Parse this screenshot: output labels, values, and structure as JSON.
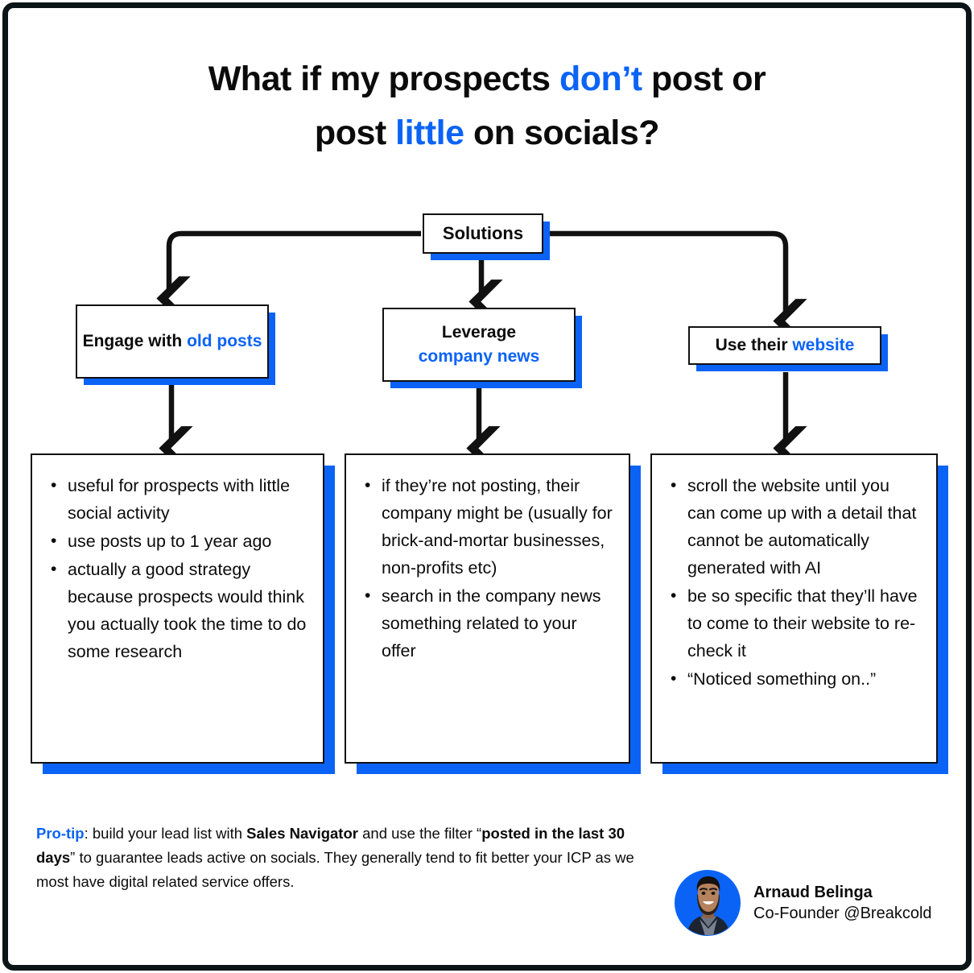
{
  "theme": {
    "accent": "#0b63f6",
    "ink": "#0b0b0b",
    "frame": "#0b1416",
    "paper": "#ffffff"
  },
  "title": {
    "line1_a": "What if my prospects ",
    "line1_hl": "don’t",
    "line1_b": " post or",
    "line2_a": "post ",
    "line2_hl": "little",
    "line2_b": " on socials?"
  },
  "diagram": {
    "root": {
      "label": "Solutions"
    },
    "branches": [
      {
        "id": "old-posts",
        "label_a": "Engage with ",
        "label_hl": "old posts",
        "label_b": "",
        "bullets": [
          "useful for prospects with little social activity",
          "use posts up to 1 year ago",
          "actually a good strategy because prospects would think you actually took the time to do some research"
        ]
      },
      {
        "id": "company-news",
        "label_a": "Leverage",
        "label_hl": "company news",
        "label_b": "",
        "bullets": [
          "if they’re not posting, their company might be (usually for brick-and-mortar businesses, non-profits etc)",
          "search in the company news something related to your offer"
        ]
      },
      {
        "id": "website",
        "label_a": "Use their ",
        "label_hl": "website",
        "label_b": "",
        "bullets": [
          "scroll the website until you can come up with a detail that cannot be automatically generated with AI",
          "be so specific that they’ll have to come to their website to re-check it",
          "“Noticed something on..”"
        ]
      }
    ]
  },
  "protip": {
    "tag": "Pro-tip",
    "s1": ": build your lead list with ",
    "b1": "Sales Navigator",
    "s2": " and use the filter “",
    "b2": "posted in the last 30 days",
    "s3": "” to guarantee leads active on socials. They generally tend to fit better your ICP as we most have digital related service offers."
  },
  "author": {
    "name": "Arnaud Belinga",
    "role": "Co-Founder @Breakcold",
    "avatar_icon": "person-photo-avatar"
  }
}
